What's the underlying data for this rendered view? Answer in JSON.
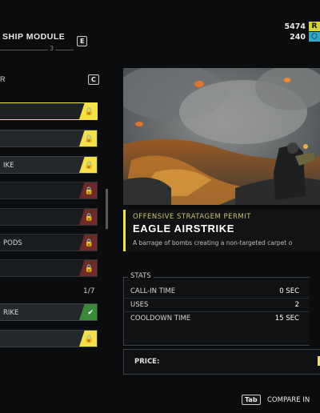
{
  "header": {
    "module_title": "SHIP MODULE",
    "module_num": "3",
    "module_key": "E",
    "category_label": "R",
    "category_key": "C"
  },
  "resources": {
    "primary_value": "5474",
    "primary_badge": "R",
    "secondary_value": "240",
    "primary_color": "#d6d233",
    "secondary_color": "#32a6c4"
  },
  "list": {
    "rows": [
      {
        "label": "",
        "status": "locked-yellow",
        "highlight": true
      },
      {
        "label": "",
        "status": "locked-yellow",
        "highlight": false
      },
      {
        "label": "IKE",
        "status": "locked-yellow",
        "highlight": false
      },
      {
        "label": "",
        "status": "locked-red",
        "highlight": false
      },
      {
        "label": "",
        "status": "locked-red",
        "highlight": false
      },
      {
        "label": "PODS",
        "status": "locked-red",
        "highlight": false
      },
      {
        "label": "",
        "status": "locked-red",
        "highlight": false
      }
    ],
    "count": "1/7",
    "rows2": [
      {
        "label": "RIKE",
        "status": "owned-green"
      },
      {
        "label": "",
        "status": "locked-yellow"
      }
    ]
  },
  "item": {
    "category": "OFFENSIVE STRATAGEM PERMIT",
    "name": "EAGLE AIRSTRIKE",
    "description": "A barrage of bombs creating a non-targeted carpet o"
  },
  "stats": {
    "title": "STATS",
    "rows": [
      {
        "label": "CALL-IN TIME",
        "value": "0 SEC"
      },
      {
        "label": "USES",
        "value": "2"
      },
      {
        "label": "COOLDOWN TIME",
        "value": "15 SEC"
      }
    ]
  },
  "price": {
    "label": "PRICE:"
  },
  "footer": {
    "tab_key": "Tab",
    "compare_label": "COMPARE IN"
  },
  "colors": {
    "accent": "#f4e14a",
    "locked_red": "#6e2a2a",
    "owned_green": "#3a8a3a"
  },
  "icons": {
    "locked": "lock-icon",
    "owned": "checkmark-icon"
  }
}
